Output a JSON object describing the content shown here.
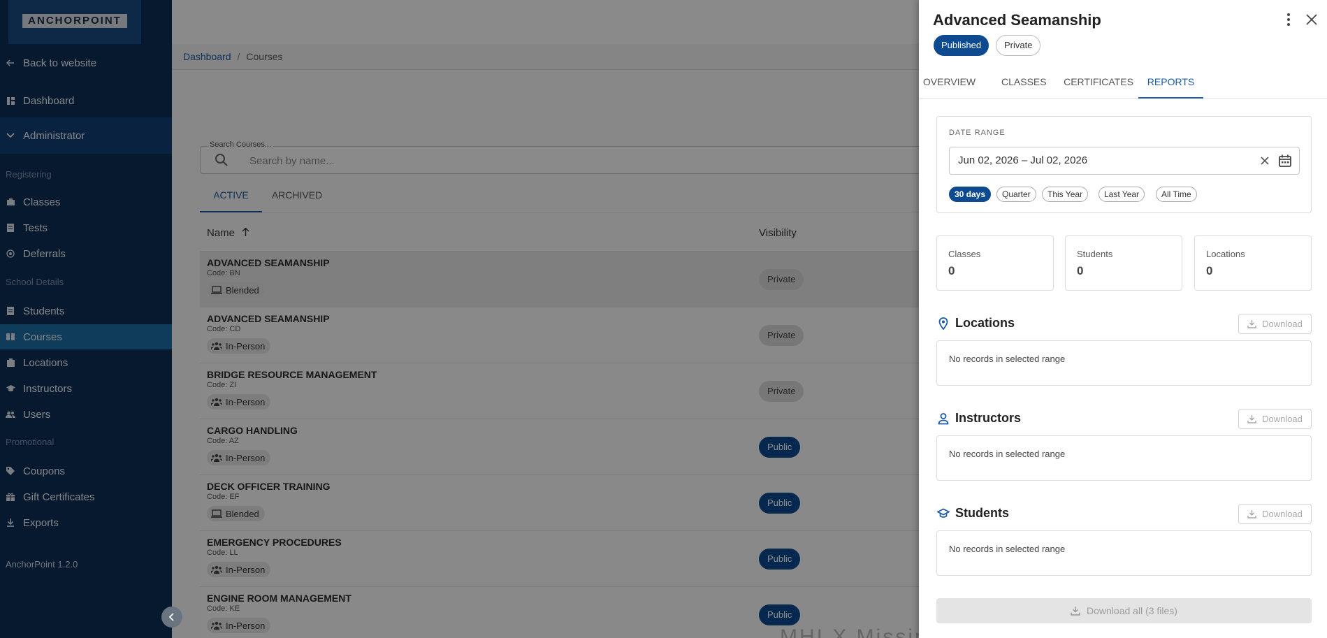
{
  "sidebar": {
    "logo": "ANCHORPOINT",
    "back_label": "Back to website",
    "dashboard_label": "Dashboard",
    "admin_label": "Administrator",
    "sections": {
      "registering": "Registering",
      "school_details": "School Details",
      "promotional": "Promotional"
    },
    "items": {
      "classes": "Classes",
      "tests": "Tests",
      "deferrals": "Deferrals",
      "students": "Students",
      "courses": "Courses",
      "locations": "Locations",
      "instructors": "Instructors",
      "users": "Users",
      "coupons": "Coupons",
      "gift_certificates": "Gift Certificates",
      "exports": "Exports"
    },
    "version": "AnchorPoint 1.2.0"
  },
  "breadcrumb": {
    "root": "Dashboard",
    "sep": "/",
    "current": "Courses"
  },
  "search": {
    "label": "Search Courses...",
    "placeholder": "Search by name..."
  },
  "list_tabs": {
    "active": "ACTIVE",
    "archived": "ARCHIVED"
  },
  "table": {
    "headers": {
      "name": "Name",
      "visibility": "Visibility"
    },
    "rows": [
      {
        "name": "ADVANCED SEAMANSHIP",
        "code": "Code: BN",
        "mode": "Blended",
        "visibility": "Private"
      },
      {
        "name": "ADVANCED SEAMANSHIP",
        "code": "Code: CD",
        "mode": "In-Person",
        "visibility": "Private"
      },
      {
        "name": "BRIDGE RESOURCE MANAGEMENT",
        "code": "Code: ZI",
        "mode": "In-Person",
        "visibility": "Private"
      },
      {
        "name": "CARGO HANDLING",
        "code": "Code: AZ",
        "mode": "In-Person",
        "visibility": "Public"
      },
      {
        "name": "DECK OFFICER TRAINING",
        "code": "Code: EF",
        "mode": "Blended",
        "visibility": "Public"
      },
      {
        "name": "EMERGENCY PROCEDURES",
        "code": "Code: LL",
        "mode": "In-Person",
        "visibility": "Public"
      },
      {
        "name": "ENGINE ROOM MANAGEMENT",
        "code": "Code: KE",
        "mode": "In-Person",
        "visibility": "Public"
      }
    ]
  },
  "watermark": "MHI X Missing License key",
  "drawer": {
    "title": "Advanced Seamanship",
    "status_badge": "Published",
    "visibility_badge": "Private",
    "tabs": {
      "overview": "OVERVIEW",
      "classes": "CLASSES",
      "certificates": "CERTIFICATES",
      "reports": "REPORTS"
    },
    "date_range": {
      "label": "DATE RANGE",
      "value": "Jun 02, 2026 – Jul 02, 2026",
      "presets": [
        "30 days",
        "Quarter",
        "This Year",
        "Last Year",
        "All Time"
      ]
    },
    "stats": {
      "classes": {
        "label": "Classes",
        "value": "0"
      },
      "students": {
        "label": "Students",
        "value": "0"
      },
      "locations": {
        "label": "Locations",
        "value": "0"
      }
    },
    "sections": {
      "locations": {
        "title": "Locations",
        "download": "Download",
        "empty": "No records in selected range"
      },
      "instructors": {
        "title": "Instructors",
        "download": "Download",
        "empty": "No records in selected range"
      },
      "students": {
        "title": "Students",
        "download": "Download",
        "empty": "No records in selected range"
      }
    },
    "download_all": "Download all (3 files)"
  },
  "colors": {
    "sidebar": "#0d2f57",
    "accent": "#1c5aa6",
    "badge": "#0d4a8f",
    "active_nav": "#1a6ea4"
  },
  "icons": {
    "back": "arrow-left-icon",
    "dashboard": "dashboard-icon",
    "admin": "chevron-down-icon",
    "search": "search-icon",
    "more": "more-vertical-icon",
    "close": "close-icon",
    "calendar": "calendar-icon",
    "location": "map-pin-icon",
    "instructor": "person-icon",
    "student": "graduation-cap-icon",
    "download": "download-icon"
  }
}
